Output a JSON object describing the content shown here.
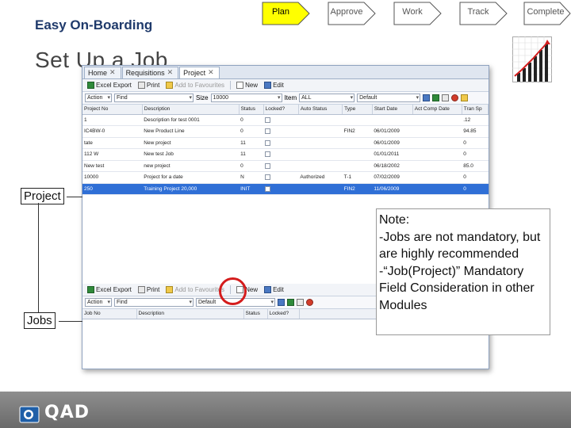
{
  "process": {
    "steps": [
      {
        "label": "Plan",
        "active": true
      },
      {
        "label": "Approve",
        "active": false
      },
      {
        "label": "Work",
        "active": false
      },
      {
        "label": "Track",
        "active": false
      },
      {
        "label": "Complete",
        "active": false
      }
    ],
    "colors": {
      "active": "#ffff00",
      "inactive": "#ffffff"
    }
  },
  "slide": {
    "subtitle": "Easy On-Boarding",
    "title": "Set Up a Job"
  },
  "window": {
    "tabs": [
      {
        "label": "Home"
      },
      {
        "label": "Requisitions"
      },
      {
        "label": "Project"
      }
    ],
    "toolbar": {
      "excel": "Excel Export",
      "print": "Print",
      "favourites": "Add to Favourites",
      "new": "New",
      "edit": "Edit"
    },
    "filter": {
      "action": "Action",
      "find": "Find",
      "size_label": "Size",
      "size_value": "10000",
      "item_label": "Item",
      "item_value": "ALL",
      "view_value": "Default"
    },
    "project_grid": {
      "columns": [
        "Project No",
        "Description",
        "Status",
        "Locked?",
        "Auto Status",
        "Type",
        "Start Date",
        "Act Comp Date",
        "Tran Sp"
      ],
      "rows": [
        [
          "1",
          "Description for test 0001",
          "0",
          "",
          "",
          "",
          "",
          "",
          ".12"
        ],
        [
          "IC4BW-0",
          "New Product Line",
          "0",
          "",
          "",
          "FIN2",
          "06/01/2009",
          "",
          "94.85"
        ],
        [
          "tate",
          "New project",
          "11",
          "",
          "",
          "",
          "06/01/2009",
          "",
          "0"
        ],
        [
          "112 W",
          "New test Job",
          "11",
          "",
          "",
          "",
          "01/01/2011",
          "",
          "0"
        ],
        [
          "New test",
          "new project",
          "0",
          "",
          "",
          "",
          "06/18/2002",
          "",
          "85.0"
        ],
        [
          "10000",
          "Project for a date",
          "N",
          "",
          "Authorized",
          "T-1",
          "07/02/2009",
          "",
          "0"
        ],
        [
          "250",
          "Training Project 20,000",
          "INIT",
          "",
          "",
          "FIN2",
          "11/06/2009",
          "",
          "0"
        ]
      ],
      "selected_row": 6
    },
    "job_filter": {
      "action": "Action",
      "find": "Find",
      "view_value": "Default"
    },
    "job_grid": {
      "columns": [
        "Job No",
        "Description",
        "Status",
        "Locked?"
      ]
    }
  },
  "labels": {
    "project": "Project",
    "jobs": "Jobs"
  },
  "note": {
    "text": "Note:\n-Jobs are not mandatory, but are highly recommended\n-“Job(Project)” Mandatory Field Consideration in other Modules"
  },
  "footer": {
    "logo_text": "QAD"
  }
}
